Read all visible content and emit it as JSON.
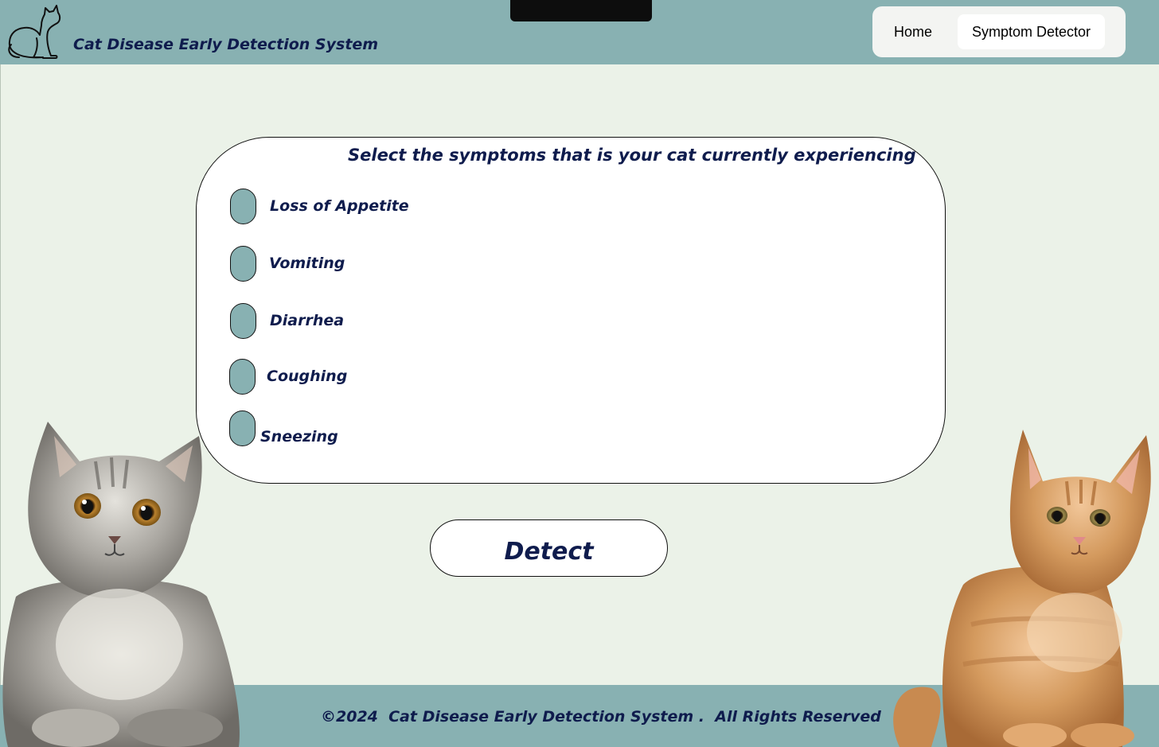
{
  "header": {
    "title": "Cat Disease Early Detection System",
    "logo_icon": "cat-silhouette-icon",
    "nav": [
      {
        "label": "Home"
      },
      {
        "label": "Symptom Detector",
        "active": true
      }
    ]
  },
  "form": {
    "title": "Select the symptoms that is your cat currently experiencing",
    "symptoms": [
      {
        "label": "Loss of Appetite",
        "checked": false
      },
      {
        "label": "Vomiting",
        "checked": false
      },
      {
        "label": "Diarrhea",
        "checked": false
      },
      {
        "label": "Coughing",
        "checked": false
      },
      {
        "label": "Sneezing",
        "checked": false
      }
    ],
    "submit_label": "Detect"
  },
  "footer": {
    "text": "©2024  Cat Disease Early Detection System .  All Rights Reserved"
  },
  "colors": {
    "header_bg": "#88b1b2",
    "page_bg": "#ebf2e8",
    "text_navy": "#0f1c4d",
    "checkbox_fill": "#88b1b2"
  }
}
